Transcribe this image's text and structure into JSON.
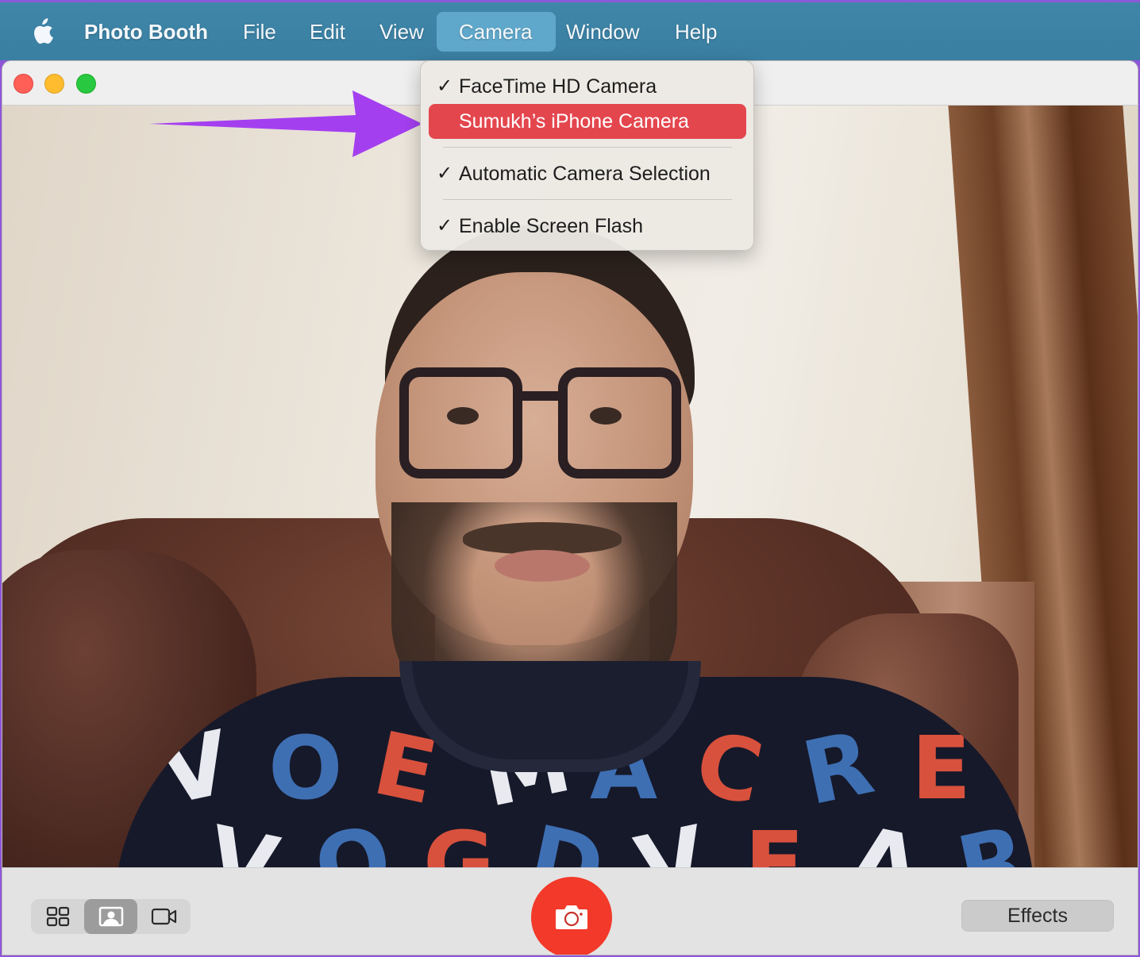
{
  "menubar": {
    "apple_icon": "apple-logo-icon",
    "app_name": "Photo Booth",
    "items": [
      {
        "label": "File"
      },
      {
        "label": "Edit"
      },
      {
        "label": "View"
      },
      {
        "label": "Camera",
        "active": true
      },
      {
        "label": "Window"
      },
      {
        "label": "Help"
      }
    ]
  },
  "window": {
    "controls": [
      "close",
      "minimize",
      "zoom"
    ]
  },
  "camera_menu": {
    "items": [
      {
        "label": "FaceTime HD Camera",
        "checked": true,
        "check": "✓"
      },
      {
        "label": "Sumukh’s iPhone Camera",
        "checked": false,
        "highlighted": true,
        "check": ""
      },
      {
        "label": "Automatic Camera Selection",
        "checked": true,
        "check": "✓"
      },
      {
        "label": "Enable Screen Flash",
        "checked": true,
        "check": "✓"
      }
    ]
  },
  "annotation": {
    "arrow_color": "#a43ff0",
    "points_to": "Sumukh’s iPhone Camera"
  },
  "preview": {
    "description": "Live camera preview of a man with glasses and beard wearing a patterned sweater, sitting on a brown leather sofa",
    "sweater_letters": [
      {
        "t": "V",
        "c": "lw"
      },
      {
        "t": "O",
        "c": "lb"
      },
      {
        "t": "E",
        "c": "lr"
      },
      {
        "t": "M",
        "c": "lw"
      },
      {
        "t": "A",
        "c": "lb"
      },
      {
        "t": "C",
        "c": "lr"
      },
      {
        "t": "R",
        "c": "lb"
      },
      {
        "t": "E",
        "c": "lr"
      },
      {
        "t": "V",
        "c": "lw"
      },
      {
        "t": "O",
        "c": "lb"
      },
      {
        "t": "G",
        "c": "lr"
      },
      {
        "t": "D",
        "c": "lb"
      },
      {
        "t": "V",
        "c": "lw"
      },
      {
        "t": "E",
        "c": "lr"
      },
      {
        "t": "A",
        "c": "lw"
      },
      {
        "t": "R",
        "c": "lb"
      }
    ]
  },
  "toolbar": {
    "view_modes": [
      {
        "name": "grid-view",
        "icon": "grid-icon",
        "selected": false
      },
      {
        "name": "single-photo",
        "icon": "portrait-icon",
        "selected": true
      },
      {
        "name": "video",
        "icon": "video-camera-icon",
        "selected": false
      }
    ],
    "shutter_icon": "camera-icon",
    "effects_label": "Effects"
  },
  "colors": {
    "menubar": "#3a7fa2",
    "menu_active": "#5fa8cb",
    "highlight": "#e4464e",
    "shutter": "#f2392a",
    "border": "#8e55d8"
  }
}
